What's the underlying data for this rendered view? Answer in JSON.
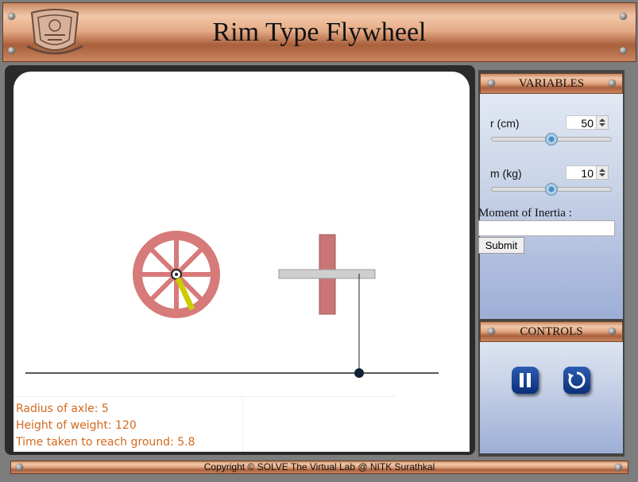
{
  "header": {
    "title": "Rim Type Flywheel",
    "logo": "nitk-emblem-logo"
  },
  "variables": {
    "heading": "VARIABLES",
    "r_label": "r (cm)",
    "r_value": "50",
    "r_level_pct": 50,
    "m_label": "m (kg)",
    "m_value": "10",
    "m_level_pct": 50,
    "moi_label": "Moment of Inertia :",
    "moi_value": "",
    "submit_label": "Submit"
  },
  "controls": {
    "heading": "CONTROLS",
    "pause_icon": "pause-icon",
    "reset_icon": "reset-icon"
  },
  "info": {
    "radius_line": "Radius of axle: 5",
    "height_line": "Height of weight: 120",
    "time_line": "Time taken to reach ground: 5.8"
  },
  "colors": {
    "wheel": "#d77a7a",
    "accent_copper": "#c98a63",
    "text_orange": "#d2691e",
    "rope_marker": "#cccc00"
  },
  "footer": {
    "text": "Copyright © SOLVE The Virtual Lab @ NITK Surathkal"
  }
}
